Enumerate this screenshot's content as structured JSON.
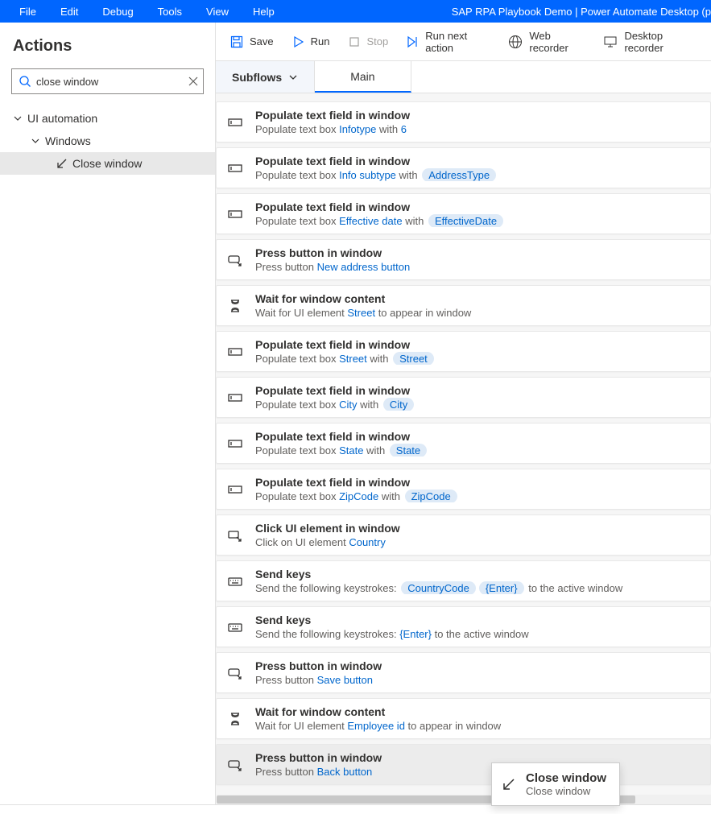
{
  "window": {
    "title": "SAP RPA Playbook Demo | Power Automate Desktop (p",
    "menu": [
      "File",
      "Edit",
      "Debug",
      "Tools",
      "View",
      "Help"
    ]
  },
  "toolbar": {
    "save": "Save",
    "run": "Run",
    "stop": "Stop",
    "run_next": "Run next action",
    "web_recorder": "Web recorder",
    "desktop_recorder": "Desktop recorder"
  },
  "sidebar": {
    "heading": "Actions",
    "search_value": "close window",
    "tree": {
      "root": "UI automation",
      "child": "Windows",
      "leaf": "Close window"
    }
  },
  "subflows_label": "Subflows",
  "tab_main": "Main",
  "steps": [
    {
      "n": "7",
      "icon": "textbox",
      "title": "Populate text field in window",
      "parts": [
        "Populate text box ",
        {
          "lk": "Infotype"
        },
        " with ",
        {
          "lk": "6"
        }
      ],
      "selected": false
    },
    {
      "n": "8",
      "icon": "textbox",
      "title": "Populate text field in window",
      "parts": [
        "Populate text box ",
        {
          "lk": "Info subtype"
        },
        " with ",
        {
          "token": "AddressType"
        }
      ],
      "selected": false
    },
    {
      "n": "9",
      "icon": "textbox",
      "title": "Populate text field in window",
      "parts": [
        "Populate text box ",
        {
          "lk": "Effective date"
        },
        " with ",
        {
          "token": "EffectiveDate"
        }
      ],
      "selected": false
    },
    {
      "n": "10",
      "icon": "press",
      "title": "Press button in window",
      "parts": [
        "Press button ",
        {
          "lk": "New address button"
        }
      ],
      "selected": false
    },
    {
      "n": "11",
      "icon": "wait",
      "title": "Wait for window content",
      "parts": [
        "Wait for UI element ",
        {
          "lk": "Street"
        },
        " to appear in window"
      ],
      "selected": false
    },
    {
      "n": "12",
      "icon": "textbox",
      "title": "Populate text field in window",
      "parts": [
        "Populate text box ",
        {
          "lk": "Street"
        },
        " with ",
        {
          "token": "Street"
        }
      ],
      "selected": false
    },
    {
      "n": "13",
      "icon": "textbox",
      "title": "Populate text field in window",
      "parts": [
        "Populate text box ",
        {
          "lk": "City"
        },
        " with ",
        {
          "token": "City"
        }
      ],
      "selected": false
    },
    {
      "n": "14",
      "icon": "textbox",
      "title": "Populate text field in window",
      "parts": [
        "Populate text box ",
        {
          "lk": "State"
        },
        " with ",
        {
          "token": "State"
        }
      ],
      "selected": false
    },
    {
      "n": "15",
      "icon": "textbox",
      "title": "Populate text field in window",
      "parts": [
        "Populate text box ",
        {
          "lk": "ZipCode"
        },
        " with ",
        {
          "token": "ZipCode"
        }
      ],
      "selected": false
    },
    {
      "n": "16",
      "icon": "click",
      "title": "Click UI element in window",
      "parts": [
        "Click on UI element ",
        {
          "lk": "Country"
        }
      ],
      "selected": false
    },
    {
      "n": "17",
      "icon": "keys",
      "title": "Send keys",
      "parts": [
        "Send the following keystrokes: ",
        {
          "token": "CountryCode"
        },
        {
          "token": "{Enter}"
        },
        " to the active window"
      ],
      "selected": false
    },
    {
      "n": "18",
      "icon": "keys",
      "title": "Send keys",
      "parts": [
        "Send the following keystrokes: ",
        {
          "lk": "{Enter}"
        },
        " to the active window"
      ],
      "selected": false
    },
    {
      "n": "19",
      "icon": "press",
      "title": "Press button in window",
      "parts": [
        "Press button ",
        {
          "lk": "Save button"
        }
      ],
      "selected": false
    },
    {
      "n": "20",
      "icon": "wait",
      "title": "Wait for window content",
      "parts": [
        "Wait for UI element ",
        {
          "lk": "Employee id"
        },
        " to appear in window"
      ],
      "selected": false
    },
    {
      "n": "21",
      "icon": "press",
      "title": "Press button in window",
      "parts": [
        "Press button ",
        {
          "lk": "Back button"
        }
      ],
      "selected": true
    }
  ],
  "tooltip": {
    "title": "Close window",
    "sub": "Close window"
  }
}
